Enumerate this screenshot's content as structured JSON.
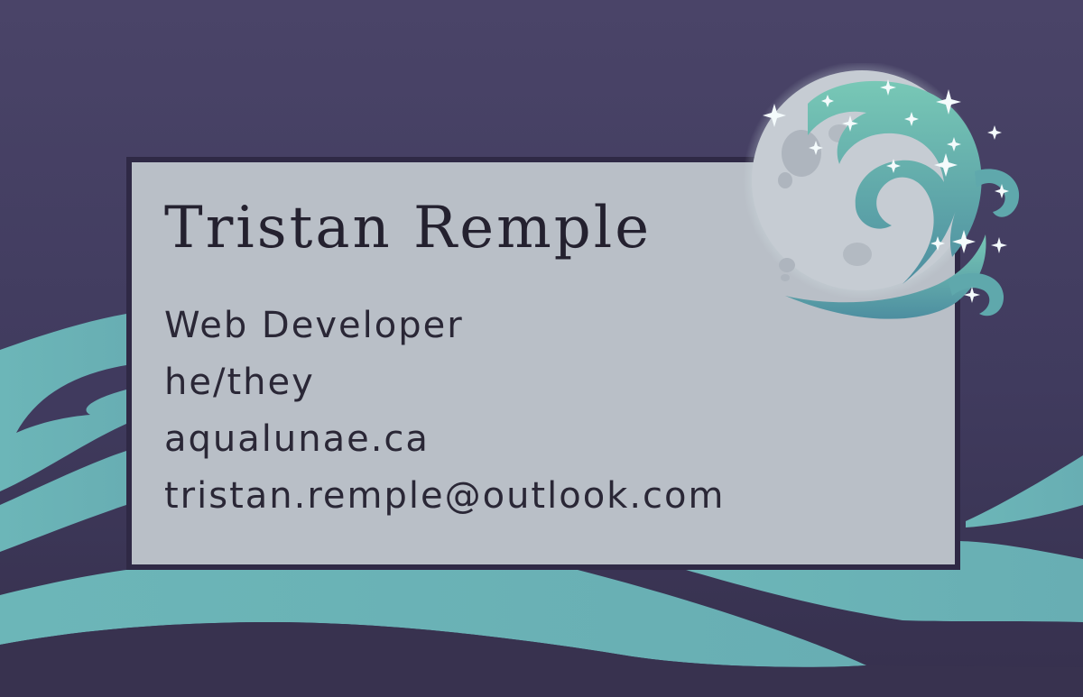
{
  "card": {
    "name": "Tristan Remple",
    "details": [
      "Web Developer",
      "he/they",
      "aqualunae.ca",
      "tristan.remple@outlook.com"
    ]
  },
  "colors": {
    "background": "#48426a",
    "card": "#b9bfc7",
    "card_border": "#2f2945",
    "wave": "#6bb3b5",
    "moon": "#c9ced4",
    "emblem": "#6dbfb0",
    "text": "#24212f"
  },
  "icons": {
    "moon": "crescent-moon-emblem",
    "waves": "ocean-waves"
  }
}
